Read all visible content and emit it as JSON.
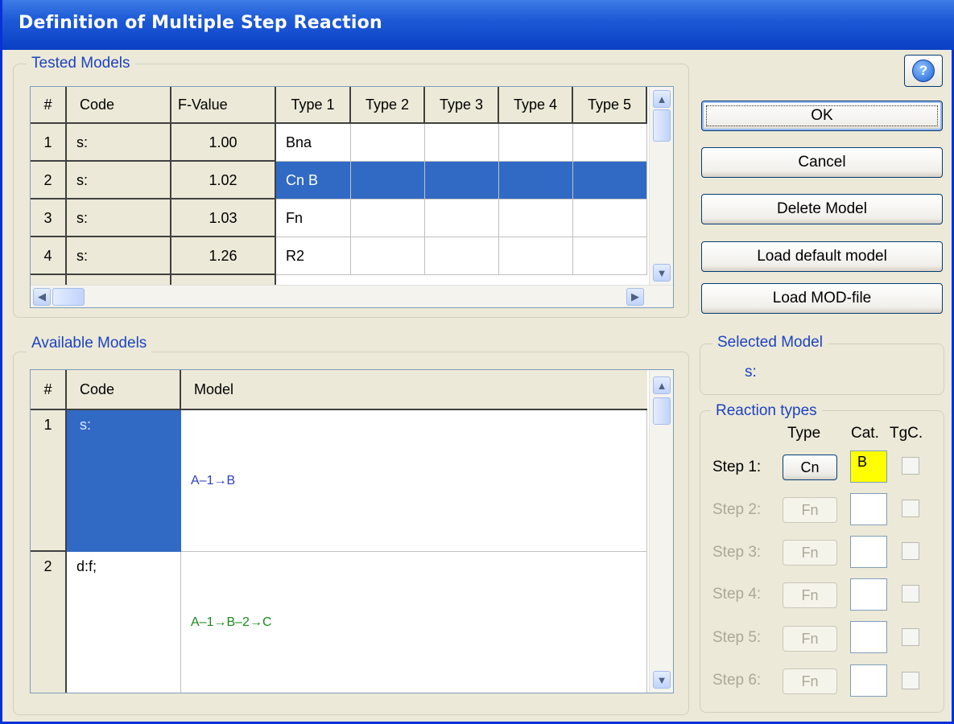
{
  "window": {
    "title": "Definition of Multiple Step Reaction"
  },
  "tested": {
    "label": "Tested Models",
    "headers": [
      "#",
      "Code",
      "F-Value",
      "Type 1",
      "Type 2",
      "Type 3",
      "Type 4",
      "Type 5"
    ],
    "rows": [
      {
        "num": "1",
        "code": "s:",
        "fvalue": "1.00",
        "type1": "Bna"
      },
      {
        "num": "2",
        "code": "s:",
        "fvalue": "1.02",
        "type1": "Cn B"
      },
      {
        "num": "3",
        "code": "s:",
        "fvalue": "1.03",
        "type1": "Fn"
      },
      {
        "num": "4",
        "code": "s:",
        "fvalue": "1.26",
        "type1": "R2"
      }
    ],
    "selected_row": 2
  },
  "buttons": {
    "ok": "OK",
    "cancel": "Cancel",
    "delete": "Delete Model",
    "load_default": "Load default model",
    "load_mod": "Load MOD-file"
  },
  "available": {
    "label": "Available Models",
    "headers": [
      "#",
      "Code",
      "Model"
    ],
    "rows": [
      {
        "num": "1",
        "code": "s:",
        "model": "A–1→B",
        "color": "#2b3fbf"
      },
      {
        "num": "2",
        "code": "d:f;",
        "model": "A–1→B–2→C",
        "color": "#1a8a1a"
      }
    ]
  },
  "selected_model": {
    "label": "Selected Model",
    "value": "s:"
  },
  "reaction": {
    "label": "Reaction types",
    "col_type": "Type",
    "col_cat": "Cat.",
    "col_tgc": "TgC.",
    "steps": [
      {
        "label": "Step 1:",
        "type": "Cn",
        "cat": "B",
        "enabled": true
      },
      {
        "label": "Step 2:",
        "type": "Fn",
        "cat": "",
        "enabled": false
      },
      {
        "label": "Step 3:",
        "type": "Fn",
        "cat": "",
        "enabled": false
      },
      {
        "label": "Step 4:",
        "type": "Fn",
        "cat": "",
        "enabled": false
      },
      {
        "label": "Step 5:",
        "type": "Fn",
        "cat": "",
        "enabled": false
      },
      {
        "label": "Step 6:",
        "type": "Fn",
        "cat": "",
        "enabled": false
      }
    ]
  },
  "colors": {
    "selection": "#316ac5",
    "highlight_cat": "#ffff00",
    "group_label": "#1c43c0"
  }
}
